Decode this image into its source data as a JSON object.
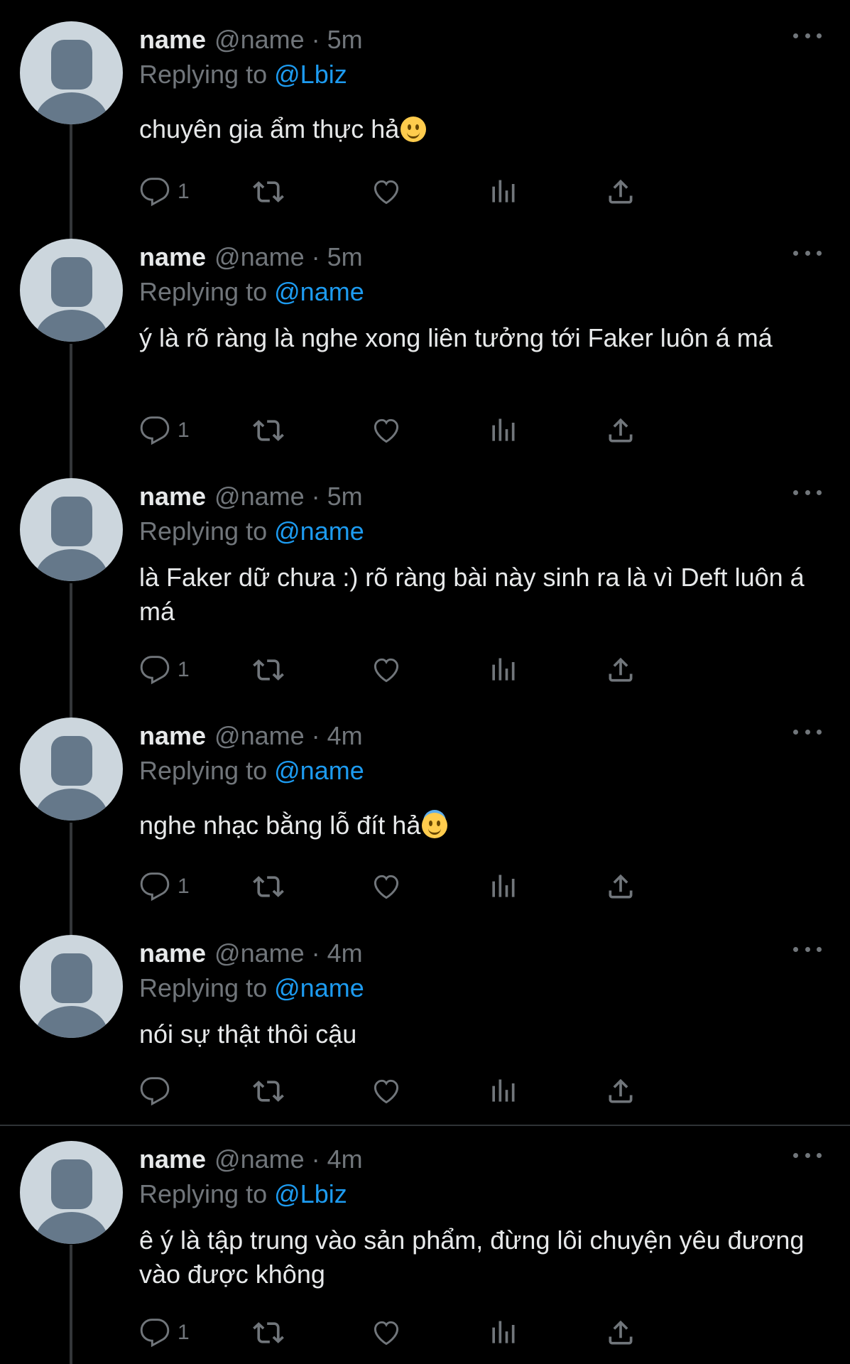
{
  "tweets": [
    {
      "name": "name",
      "handle": "@name",
      "separator": "·",
      "time": "5m",
      "replying_prefix": "Replying to",
      "replying_to": "@Lbiz",
      "text": "chuyên gia ẩm thực hả",
      "emoji": "slightly-smiling-face",
      "reply_count": "1"
    },
    {
      "name": "name",
      "handle": "@name",
      "separator": "·",
      "time": "5m",
      "replying_prefix": "Replying to",
      "replying_to": "@name",
      "text": "ý là rõ ràng là nghe xong liên tưởng tới Faker luôn á má",
      "emoji": "",
      "reply_count": "1"
    },
    {
      "name": "name",
      "handle": "@name",
      "separator": "·",
      "time": "5m",
      "replying_prefix": "Replying to",
      "replying_to": "@name",
      "text": "là Faker dữ chưa :) rõ ràng bài này sinh ra là vì Deft luôn á má",
      "emoji": "",
      "reply_count": "1"
    },
    {
      "name": "name",
      "handle": "@name",
      "separator": "·",
      "time": "4m",
      "replying_prefix": "Replying to",
      "replying_to": "@name",
      "text": "nghe nhạc bằng lỗ đít hả",
      "emoji": "smiling-face-with-halo",
      "reply_count": "1"
    },
    {
      "name": "name",
      "handle": "@name",
      "separator": "·",
      "time": "4m",
      "replying_prefix": "Replying to",
      "replying_to": "@name",
      "text": "nói sự thật thôi cậu",
      "emoji": "",
      "reply_count": ""
    },
    {
      "name": "name",
      "handle": "@name",
      "separator": "·",
      "time": "4m",
      "replying_prefix": "Replying to",
      "replying_to": "@Lbiz",
      "text": "ê ý là tập trung vào sản phẩm, đừng lôi chuyện yêu đương vào được không",
      "emoji": "",
      "reply_count": "1"
    }
  ],
  "icons": {
    "reply": "reply-icon",
    "retweet": "retweet-icon",
    "like": "heart-icon",
    "views": "views-icon",
    "share": "share-icon",
    "more": "more-icon"
  },
  "colors": {
    "background": "#000000",
    "text": "#e7e9ea",
    "muted": "#71767b",
    "link": "#1d9bf0",
    "avatar_bg": "#ccd6dd",
    "avatar_fg": "#65788a"
  }
}
